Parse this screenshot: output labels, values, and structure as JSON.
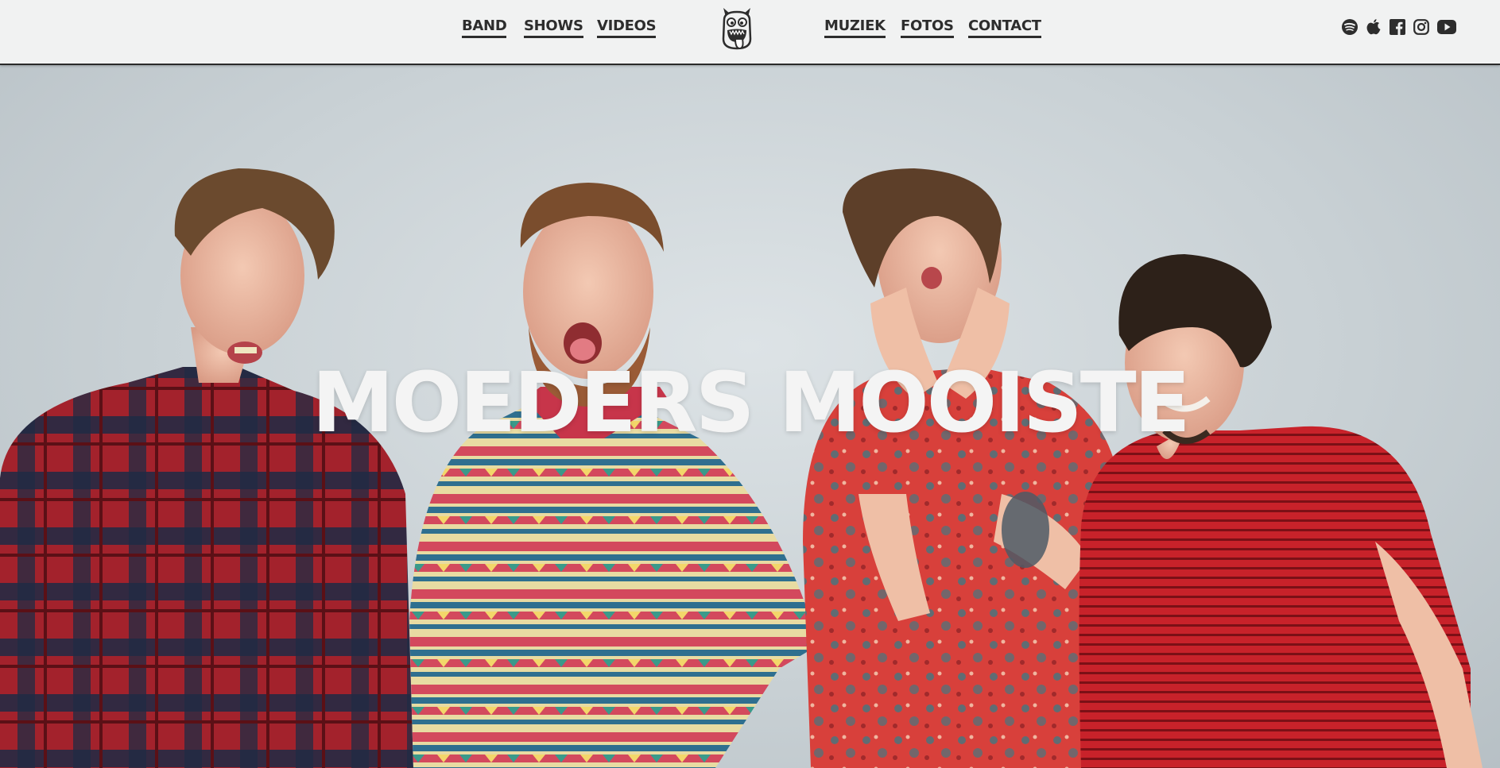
{
  "nav": {
    "left": [
      {
        "label": "BAND"
      },
      {
        "label": "SHOWS"
      },
      {
        "label": "VIDEOS"
      }
    ],
    "right": [
      {
        "label": "MUZIEK"
      },
      {
        "label": "FOTOS"
      },
      {
        "label": "CONTACT"
      }
    ]
  },
  "logo": {
    "icon": "monster-logo-icon"
  },
  "social": [
    {
      "icon": "spotify-icon"
    },
    {
      "icon": "apple-icon"
    },
    {
      "icon": "facebook-icon"
    },
    {
      "icon": "instagram-icon"
    },
    {
      "icon": "youtube-icon"
    }
  ],
  "hero": {
    "title": "MOEDERS MOOISTE"
  },
  "colors": {
    "header_bg": "#f1f2f2",
    "nav_text": "#2d2d2d",
    "title": "#f4f4f4",
    "wall": "#c9d1d5",
    "plaid_red": "#a3222c",
    "plaid_navy": "#1f2a44",
    "stripe_red": "#c8222a",
    "floral_red": "#d8403b"
  }
}
